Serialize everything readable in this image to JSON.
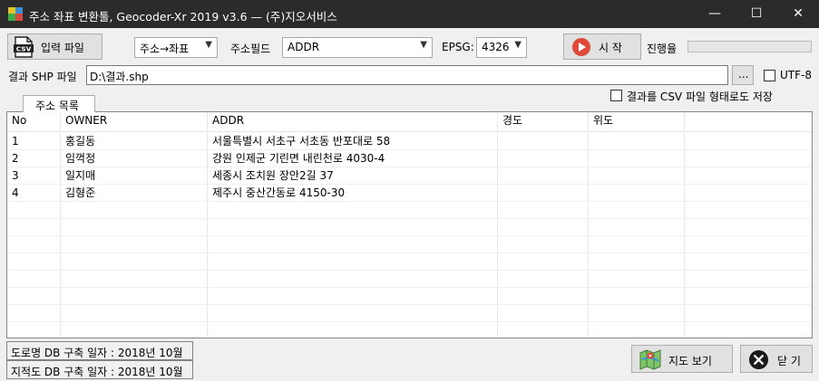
{
  "window": {
    "title": "주소 좌표 변환툴, Geocoder-Xr 2019 v3.6 — (주)지오서비스",
    "minimize_glyph": "—",
    "maximize_glyph": "☐",
    "close_glyph": "✕"
  },
  "toolbar": {
    "input_file_label": "입력 파일",
    "csv_icon_text": "CSV",
    "mode_value": "주소→좌표",
    "address_field_label": "주소필드",
    "address_field_value": "ADDR",
    "epsg_label": "EPSG:",
    "epsg_value": "4326",
    "start_label": "시 작",
    "progress_label": "진행율",
    "progress_value": 0
  },
  "output": {
    "shp_label": "결과 SHP 파일",
    "shp_path": "D:\\결과.shp",
    "browse_label": "...",
    "utf8_label": "UTF-8",
    "utf8_checked": false,
    "csv_export_label": "결과를 CSV 파일 형태로도 저장",
    "csv_export_checked": false
  },
  "tab": {
    "label": "주소 목록"
  },
  "table": {
    "columns": [
      "No",
      "OWNER",
      "ADDR",
      "경도",
      "위도"
    ],
    "rows": [
      [
        "1",
        "홍길동",
        "서울특별시 서초구 서초동 반포대로 58",
        "",
        ""
      ],
      [
        "2",
        "임꺽정",
        "강원 인제군 기린면 내린천로 4030-4",
        "",
        ""
      ],
      [
        "3",
        "일지매",
        "세종시 조치원 장안2길 37",
        "",
        ""
      ],
      [
        "4",
        "김형준",
        "제주시 중산간동로 4150-30",
        "",
        ""
      ]
    ]
  },
  "footer": {
    "road_db_date": "도로명 DB 구축 일자 : 2018년 10월",
    "cadastral_db_date": "지적도 DB 구축 일자 : 2018년 10월",
    "map_view_label": "지도 보기",
    "close_label": "닫 기"
  },
  "colors": {
    "titlebar": "#2b2b2b",
    "start_icon": "#e04a3a",
    "close_icon": "#1a1a1a",
    "progress": "#06b025"
  }
}
